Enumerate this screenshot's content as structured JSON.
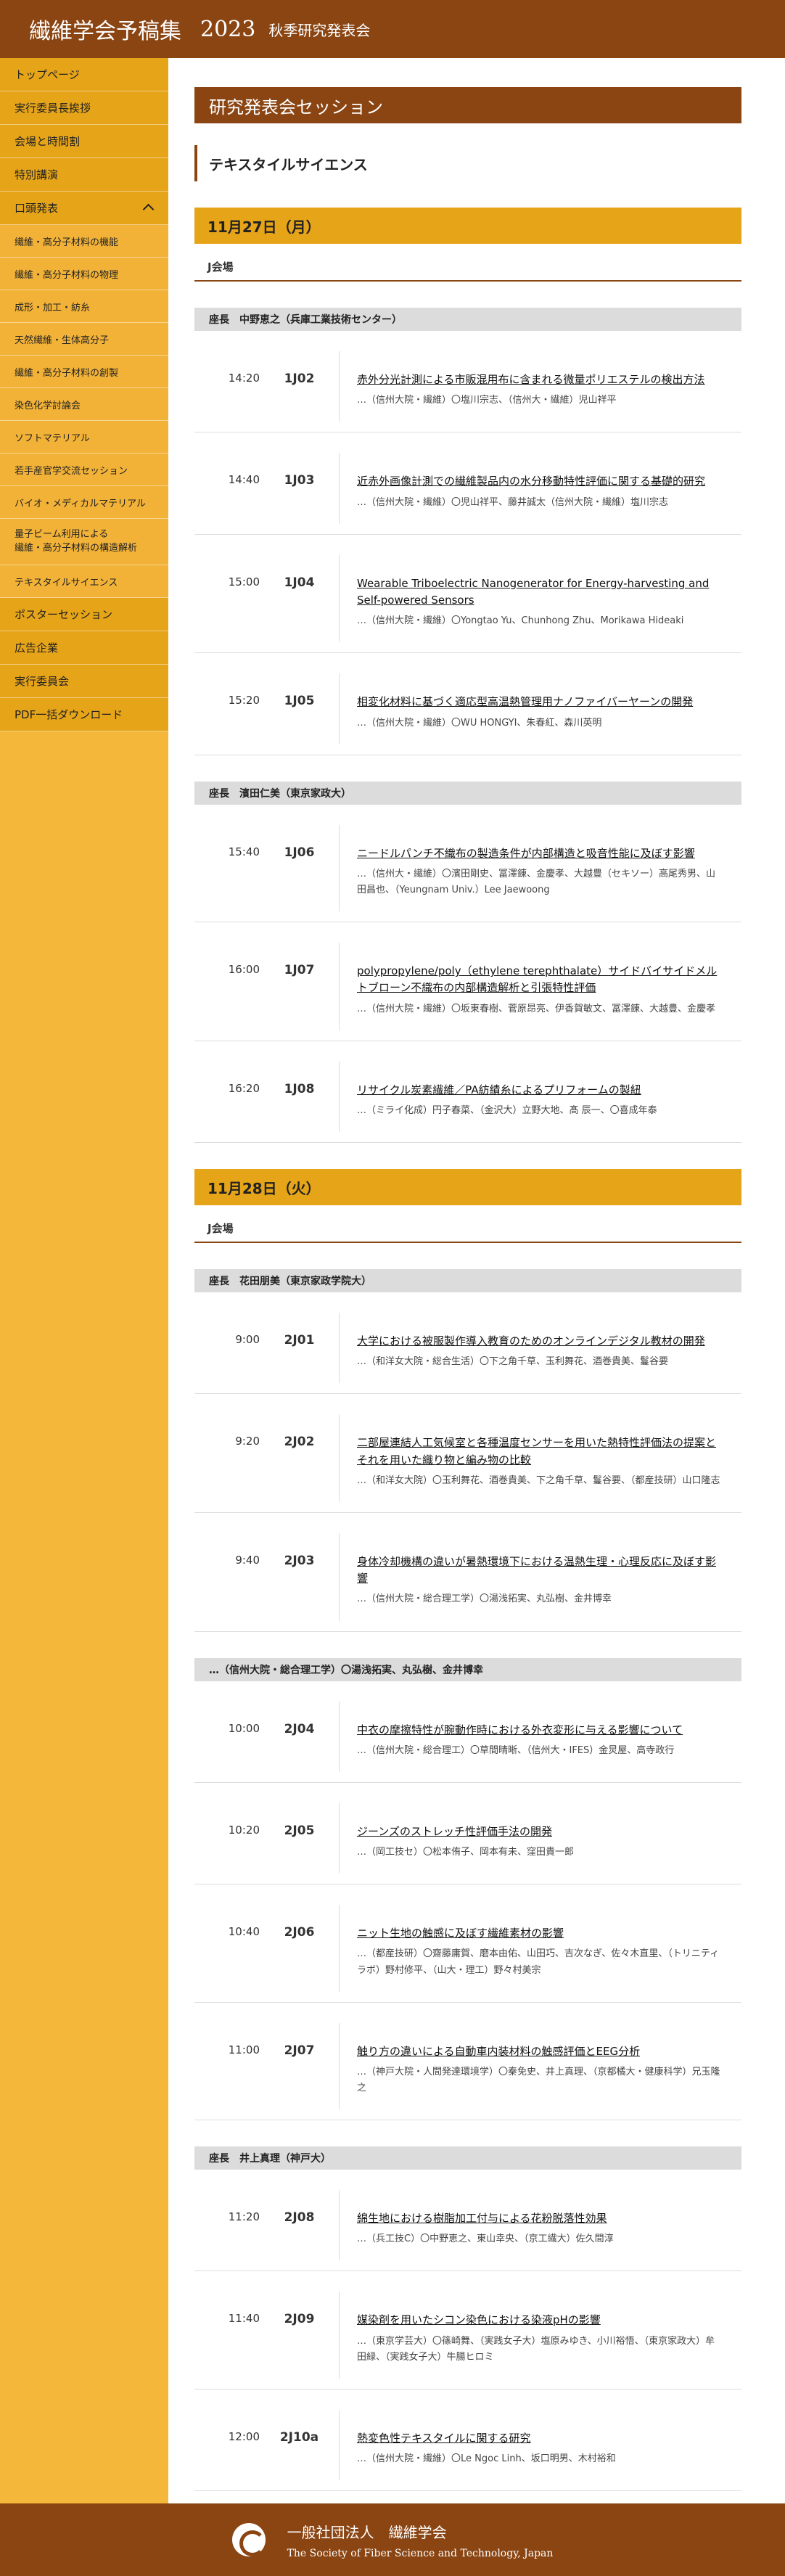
{
  "header": {
    "title": "繊維学会予稿集",
    "year": "2023",
    "subtitle": "秋季研究発表会"
  },
  "sidebar": [
    {
      "label": "トップページ"
    },
    {
      "label": "実行委員長挨拶"
    },
    {
      "label": "会場と時間割"
    },
    {
      "label": "特別講演"
    },
    {
      "label": "口頭発表",
      "parent": true
    },
    {
      "label": "繊維・高分子材料の機能",
      "sub": true
    },
    {
      "label": "繊維・高分子材料の物理",
      "sub": true
    },
    {
      "label": "成形・加工・紡糸",
      "sub": true
    },
    {
      "label": "天然繊維・生体高分子",
      "sub": true
    },
    {
      "label": "繊維・高分子材料の創製",
      "sub": true
    },
    {
      "label": "染色化学討論会",
      "sub": true
    },
    {
      "label": "ソフトマテリアル",
      "sub": true
    },
    {
      "label": "若手産官学交流セッション",
      "sub": true
    },
    {
      "label": "バイオ・メディカルマテリアル",
      "sub": true
    },
    {
      "label": "量子ビーム利用による\n繊維・高分子材料の構造解析",
      "sub": true,
      "two": true
    },
    {
      "label": "テキスタイルサイエンス",
      "sub": true
    },
    {
      "label": "ポスターセッション"
    },
    {
      "label": "広告企業"
    },
    {
      "label": "実行委員会"
    },
    {
      "label": "PDF一括ダウンロード"
    }
  ],
  "main": {
    "page_title": "研究発表会セッション",
    "section_title": "テキスタイルサイエンス"
  },
  "days": [
    {
      "date": "11月27日（月）",
      "room": "J会場",
      "blocks": [
        {
          "chair": "座長　中野恵之（兵庫工業技術センター）",
          "talks": [
            {
              "time": "14:20",
              "code": "1J02",
              "title": "赤外分光計測による市販混用布に含まれる微量ポリエステルの検出方法",
              "authors": "…（信州大院・繊維）〇塩川宗志、（信州大・繊維）児山祥平"
            },
            {
              "time": "14:40",
              "code": "1J03",
              "title": "近赤外画像計測での繊維製品内の水分移動特性評価に関する基礎的研究",
              "authors": "…（信州大院・繊維）〇児山祥平、藤井誠太（信州大院・繊維）塩川宗志"
            },
            {
              "time": "15:00",
              "code": "1J04",
              "title": "Wearable Triboelectric Nanogenerator for Energy-harvesting and Self-powered Sensors",
              "authors": "…（信州大院・繊維）〇Yongtao Yu、Chunhong Zhu、Morikawa Hideaki"
            },
            {
              "time": "15:20",
              "code": "1J05",
              "title": "相変化材料に基づく適応型高温熱管理用ナノファイバーヤーンの開発",
              "authors": "…（信州大院・繊維）〇WU HONGYI、朱春紅、森川英明"
            }
          ]
        },
        {
          "chair": "座長　濱田仁美（東京家政大）",
          "talks": [
            {
              "time": "15:40",
              "code": "1J06",
              "title": "ニードルパンチ不織布の製造条件が内部構造と吸音性能に及ぼす影響",
              "authors": "…（信州大・繊維）〇濱田剛史、冨澤錬、金慶孝、大越豊（セキソー）高尾秀男、山田昌也、（Yeungnam Univ.）Lee Jaewoong"
            },
            {
              "time": "16:00",
              "code": "1J07",
              "title": "polypropylene/poly（ethylene terephthalate）サイドバイサイドメルトブローン不織布の内部構造解析と引張特性評価",
              "authors": "…（信州大院・繊維）〇坂東春樹、菅原昂亮、伊香賀敏文、冨澤錬、大越豊、金慶孝"
            },
            {
              "time": "16:20",
              "code": "1J08",
              "title": "リサイクル炭素繊維／PA紡績糸によるプリフォームの製紐",
              "authors": "…（ミライ化成）円子春菜、（金沢大）立野大地、髙 辰一、〇喜成年泰"
            }
          ]
        }
      ]
    },
    {
      "date": "11月28日（火）",
      "room": "J会場",
      "blocks": [
        {
          "chair": "座長　花田朋美（東京家政学院大）",
          "talks": [
            {
              "time": "9:00",
              "code": "2J01",
              "title": "大学における被服製作導入教育のためのオンラインデジタル教材の開発",
              "authors": "…（和洋女大院・総合生活）〇下之角千草、玉利舞花、酒巻貴美、鬘谷要"
            },
            {
              "time": "9:20",
              "code": "2J02",
              "title": "二部屋連結人工気候室と各種温度センサーを用いた熱特性評価法の提案とそれを用いた織り物と編み物の比較",
              "authors": "…（和洋女大院）〇玉利舞花、酒巻貴美、下之角千草、鬘谷要、（都産技研）山口隆志"
            },
            {
              "time": "9:40",
              "code": "2J03",
              "title": "身体冷却機構の違いが暑熱環境下における温熱生理・心理反応に及ぼす影響",
              "authors": "…（信州大院・総合理工学）〇湯浅拓実、丸弘樹、金井博幸"
            }
          ]
        },
        {
          "chair": "…（信州大院・総合理工学）〇湯浅拓実、丸弘樹、金井博幸",
          "talks": [
            {
              "time": "10:00",
              "code": "2J04",
              "title": "中衣の摩擦特性が腕動作時における外衣変形に与える影響について",
              "authors": "…（信州大院・総合理工）〇草間晴晰、（信州大・IFES）金炅屋、高寺政行"
            },
            {
              "time": "10:20",
              "code": "2J05",
              "title": "ジーンズのストレッチ性評価手法の開発",
              "authors": "…（岡工技セ）〇松本侑子、岡本有未、窪田貴一郎"
            },
            {
              "time": "10:40",
              "code": "2J06",
              "title": "ニット生地の触感に及ぼす繊維素材の影響",
              "authors": "…（都産技研）〇齋藤庸賀、磨本由佑、山田巧、吉次なぎ、佐々木直里、（トリニティラボ）野村修平、（山大・理工）野々村美宗"
            },
            {
              "time": "11:00",
              "code": "2J07",
              "title": "触り方の違いによる自動車内装材料の触感評価とEEG分析",
              "authors": "…（神戸大院・人間発達環境学）〇秦免史、井上真理、（京都橘大・健康科学）兄玉隆之"
            }
          ]
        },
        {
          "chair": "座長　井上真理（神戸大）",
          "talks": [
            {
              "time": "11:20",
              "code": "2J08",
              "title": "綿生地における樹脂加工付与による花粉脱落性効果",
              "authors": "…（兵工技C）〇中野恵之、東山幸央、（京工繊大）佐久間淳"
            },
            {
              "time": "11:40",
              "code": "2J09",
              "title": "媒染剤を用いたシコン染色における染液pHの影響",
              "authors": "…（東京学芸大）〇篠崎舞、（実践女子大）塩原みゆき、小川裕悟、（東京家政大）牟田緑、（実践女子大）牛腸ヒロミ"
            },
            {
              "time": "12:00",
              "code": "2J10a",
              "title": "熱変色性テキスタイルに関する研究",
              "authors": "…（信州大院・繊維）〇Le Ngoc Linh、坂口明男、木村裕和"
            }
          ]
        }
      ]
    }
  ],
  "footer": {
    "org": "一般社団法人　繊維学会",
    "org_en": "The Society of Fiber Science and Technology, Japan"
  }
}
